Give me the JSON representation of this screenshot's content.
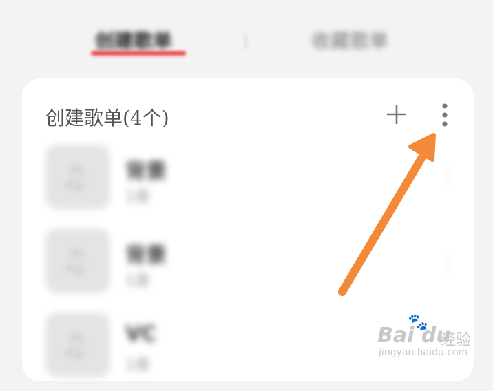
{
  "tabs": [
    {
      "label": "创建歌单",
      "active": true
    },
    {
      "label": "收藏歌单",
      "active": false
    }
  ],
  "accent_color": "#e94b4b",
  "arrow_color": "#f28a3a",
  "section": {
    "title": "创建歌单(4个)",
    "add_icon": "plus-icon",
    "more_icon": "vertical-ellipsis-icon"
  },
  "playlists": [
    {
      "name": "背景",
      "count": "1首"
    },
    {
      "name": "背景",
      "count": "1首"
    },
    {
      "name": "VC",
      "count": "1首"
    }
  ],
  "watermark": {
    "brand": "Bai  du",
    "cn": "经验",
    "url": "jingyan.baidu.com"
  }
}
